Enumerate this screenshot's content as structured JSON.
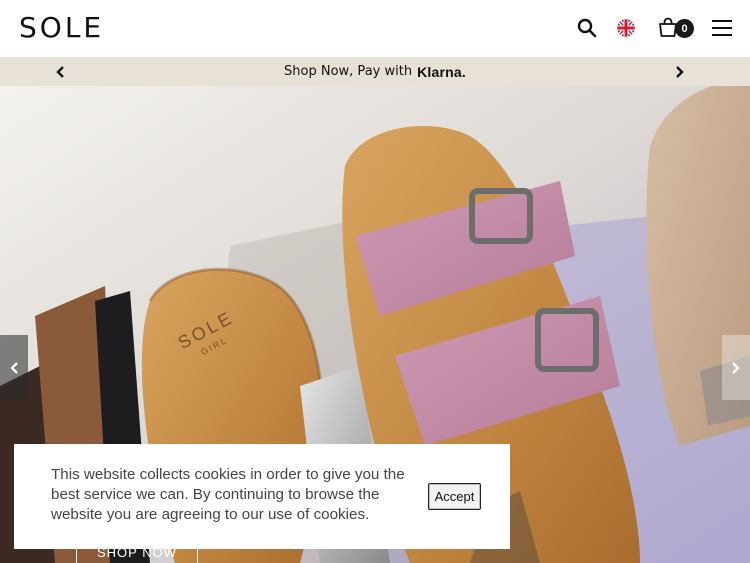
{
  "header": {
    "logo": "SOLE",
    "cart_count": "0",
    "icons": {
      "search": "search-icon",
      "language": "uk-flag-icon",
      "cart": "shopping-bag-icon",
      "menu": "hamburger-menu-icon"
    }
  },
  "promo_bar": {
    "text": "Shop Now, Pay with",
    "brand": "Klarna.",
    "icons": {
      "prev": "chevron-left-icon",
      "next": "chevron-right-icon"
    }
  },
  "hero": {
    "cta_label": "SHOP NOW",
    "footbed_stamp": "SOLE",
    "footbed_stamp_sub": "GIRL",
    "icons": {
      "prev": "chevron-left-icon",
      "next": "chevron-right-icon"
    }
  },
  "cookie_banner": {
    "message": "This website collects cookies in order to give you the best service we can. By continuing to browse the website you are agreeing to our use of cookies.",
    "accept_label": "Accept"
  },
  "colors": {
    "promo_bg": "#e8e1d8",
    "cork": "#c98f4a",
    "lilac_suede": "#c38ca7",
    "tan_suede": "#cdb096",
    "backdrop_lavender": "#a9a2d6"
  }
}
